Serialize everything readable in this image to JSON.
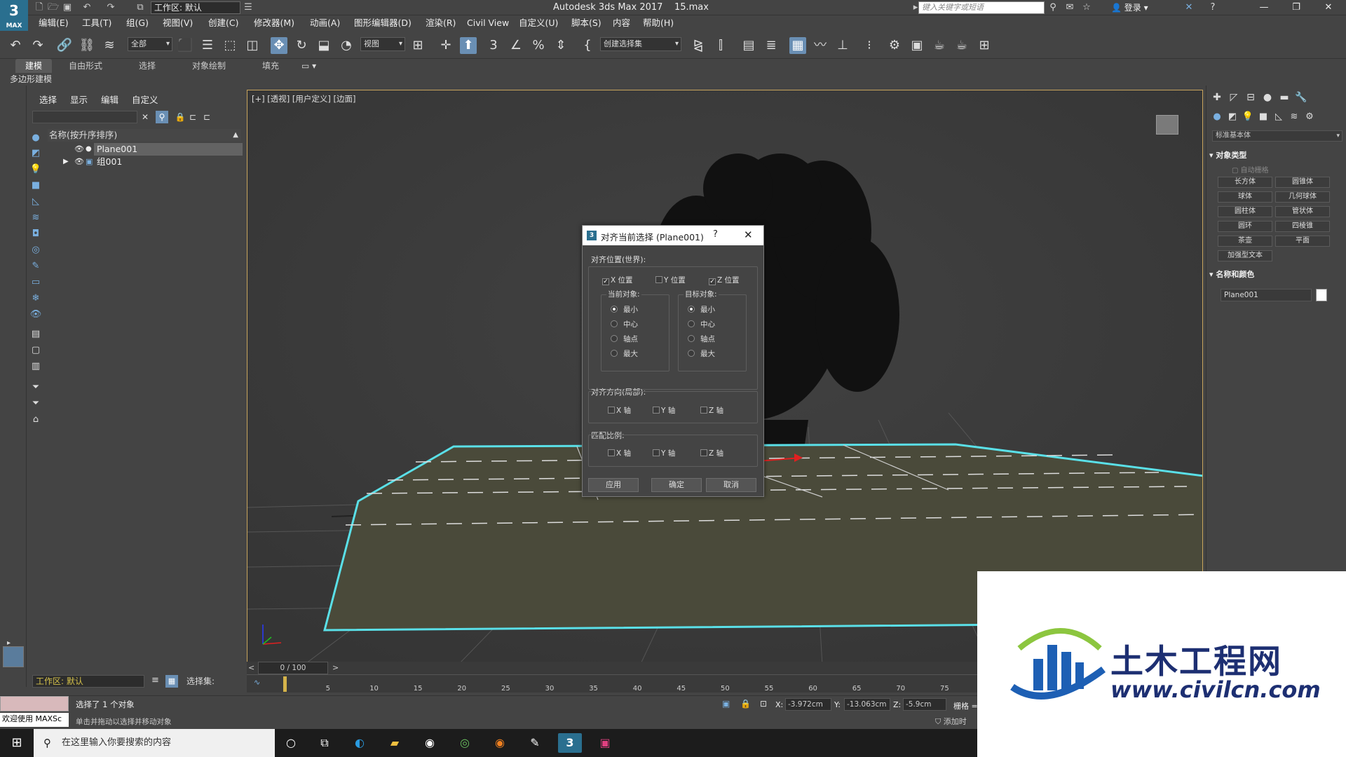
{
  "title_bar": {
    "logo_text": "3",
    "logo_sub": "MAX",
    "workspace": "工作区: 默认",
    "app_title": "Autodesk 3ds Max 2017",
    "file_name": "15.max",
    "search_placeholder": "键入关键字或短语",
    "login_label": "登录",
    "window_buttons": [
      "—",
      "❐",
      "✕"
    ]
  },
  "menus": [
    "编辑(E)",
    "工具(T)",
    "组(G)",
    "视图(V)",
    "创建(C)",
    "修改器(M)",
    "动画(A)",
    "图形编辑器(D)",
    "渲染(R)",
    "Civil View",
    "自定义(U)",
    "脚本(S)",
    "内容",
    "帮助(H)"
  ],
  "toolbar": {
    "filter_combo": "全部",
    "coord_combo": "视图",
    "selection_set_combo": "创建选择集"
  },
  "ribbon": {
    "tabs": [
      "建模",
      "自由形式",
      "选择",
      "对象绘制",
      "填充"
    ],
    "active_tab": "建模",
    "sub_label": "多边形建模"
  },
  "scene_explorer": {
    "menus": [
      "选择",
      "显示",
      "编辑",
      "自定义"
    ],
    "column_header": "名称(按升序排序)",
    "rows": [
      {
        "name": "Plane001",
        "selected": true
      },
      {
        "name": "组001",
        "selected": false
      }
    ]
  },
  "viewport": {
    "label": "[+] [透视] [用户定义] [边面]"
  },
  "dialog": {
    "title": "对齐当前选择 (Plane001)",
    "help_glyph": "?",
    "close_glyph": "✕",
    "align_position_label": "对齐位置(世界):",
    "position_checks": [
      {
        "label": "X 位置",
        "checked": true
      },
      {
        "label": "Y 位置",
        "checked": false
      },
      {
        "label": "Z 位置",
        "checked": true
      }
    ],
    "current_object_label": "当前对象:",
    "target_object_label": "目标对象:",
    "current_options": [
      {
        "label": "最小",
        "selected": true
      },
      {
        "label": "中心",
        "selected": false
      },
      {
        "label": "轴点",
        "selected": false
      },
      {
        "label": "最大",
        "selected": false
      }
    ],
    "target_options": [
      {
        "label": "最小",
        "selected": true
      },
      {
        "label": "中心",
        "selected": false
      },
      {
        "label": "轴点",
        "selected": false
      },
      {
        "label": "最大",
        "selected": false
      }
    ],
    "align_orientation_label": "对齐方向(局部):",
    "orientation_checks": [
      {
        "label": "X 轴",
        "checked": false
      },
      {
        "label": "Y 轴",
        "checked": false
      },
      {
        "label": "Z 轴",
        "checked": false
      }
    ],
    "match_scale_label": "匹配比例:",
    "scale_checks": [
      {
        "label": "X 轴",
        "checked": false
      },
      {
        "label": "Y 轴",
        "checked": false
      },
      {
        "label": "Z 轴",
        "checked": false
      }
    ],
    "buttons": {
      "apply": "应用",
      "ok": "确定",
      "cancel": "取消"
    }
  },
  "command_panel": {
    "category_combo": "标准基本体",
    "object_type_header": "对象类型",
    "autogrid_label": "自动栅格",
    "object_buttons": [
      "长方体",
      "圆锥体",
      "球体",
      "几何球体",
      "圆柱体",
      "管状体",
      "圆环",
      "四棱锥",
      "茶壶",
      "平面",
      "加强型文本"
    ],
    "name_color_header": "名称和颜色",
    "object_name": "Plane001"
  },
  "timeline": {
    "frame_range": "0 / 100",
    "prev_glyph": "<",
    "next_glyph": ">",
    "ticks": [
      "5",
      "10",
      "15",
      "20",
      "25",
      "30",
      "35",
      "40",
      "45",
      "50",
      "55",
      "60",
      "65",
      "70",
      "75"
    ],
    "current_frame": 0,
    "total_frames": 100
  },
  "workspace_bar": {
    "workspace": "工作区: 默认",
    "selection_set_label": "选择集:"
  },
  "status_bar": {
    "maxscript_label": "欢迎使用 MAXSc",
    "status_line1": "选择了 1 个对象",
    "status_line2": "单击并拖动以选择并移动对象",
    "x_label": "X:",
    "x_value": "-3.972cm",
    "y_label": "Y:",
    "y_value": "-13.063cm",
    "z_label": "Z:",
    "z_value": "-5.9cm",
    "grid_label": "栅格 =",
    "add_time_label": "添加时"
  },
  "taskbar": {
    "search_placeholder": "在这里输入你要搜索的内容"
  },
  "watermark": {
    "text_cn": "土木工程网",
    "text_url": "www.civilcn.com"
  },
  "colors": {
    "accent_blue": "#6a8fb4",
    "viewport_border": "#c9a55d",
    "selection_cyan": "#5ae0e8",
    "watermark_blue": "#1d2f72",
    "watermark_green": "#8cc63f"
  }
}
